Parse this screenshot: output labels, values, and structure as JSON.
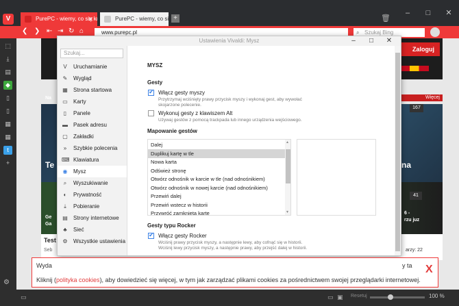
{
  "browser": {
    "logo": "V",
    "tabs": [
      {
        "title": "PurePC - wiemy, co się kręc"
      },
      {
        "title": "PurePC - wiemy, co się kręc"
      }
    ],
    "new_tab": "+",
    "url": "www.purepc.pl",
    "search_placeholder": "Szukaj Bing",
    "window_controls": [
      "–",
      "□",
      "✕"
    ]
  },
  "site": {
    "login": "Zaloguj",
    "section": "Więcej",
    "badge1": "167",
    "badge2": "41",
    "text_left1": "Na",
    "text_left2": "Te",
    "text_left3": "Ge",
    "text_left4": "Ga",
    "text_right1": "na",
    "text_right2": "6 -",
    "text_right3": "rzu juz",
    "footer_title": "Test",
    "footer_sub": "Seb",
    "footer_right": "arzy: 22"
  },
  "dialog": {
    "title": "Ustawienia Vivaldi: Mysz",
    "controls": [
      "–",
      "□",
      "✕"
    ],
    "search_placeholder": "Szukaj...",
    "nav": [
      {
        "label": "Uruchamianie",
        "icon": "V"
      },
      {
        "label": "Wygląd",
        "icon": "✎"
      },
      {
        "label": "Strona startowa",
        "icon": "▦"
      },
      {
        "label": "Karty",
        "icon": "▭"
      },
      {
        "label": "Panele",
        "icon": "▯"
      },
      {
        "label": "Pasek adresu",
        "icon": "▬"
      },
      {
        "label": "Zakładki",
        "icon": "▢"
      },
      {
        "label": "Szybkie polecenia",
        "icon": "»"
      },
      {
        "label": "Klawiatura",
        "icon": "⌨"
      },
      {
        "label": "Mysz",
        "icon": "◉"
      },
      {
        "label": "Wyszukiwanie",
        "icon": "⌕"
      },
      {
        "label": "Prywatność",
        "icon": "◐"
      },
      {
        "label": "Pobieranie",
        "icon": "⤓"
      },
      {
        "label": "Strony internetowe",
        "icon": "▤"
      },
      {
        "label": "Sieć",
        "icon": "♣"
      },
      {
        "label": "Wszystkie ustawienia",
        "icon": "⚙"
      }
    ],
    "heading": "MYSZ",
    "gestures_heading": "Gesty",
    "gesture_enable": "Włącz gesty myszy",
    "gesture_enable_desc1": "Przytrzymaj wciśnięty prawy przycisk myszy i wykonaj gest, aby wywołać",
    "gesture_enable_desc2": "skojarzone polecenie.",
    "gesture_alt": "Wykonuj gesty z klawiszem Alt",
    "gesture_alt_desc": "Używaj gestów z pomocą trackpada lub innego urządzenia wejściowego.",
    "mapping_heading": "Mapowanie gestów",
    "gestures": [
      "Dalej",
      "Duplikuj kartę w tle",
      "Nowa karta",
      "Odśwież stronę",
      "Otwórz odnośnik w karcie w tle (nad odnośnikiem)",
      "Otwórz odnośnik w nowej karcie (nad odnośnikiem)",
      "Przewiń dalej",
      "Przewiń wstecz w historii",
      "Przywróć zamkniętą kartę"
    ],
    "rocker_heading": "Gesty typu Rocker",
    "rocker_enable": "Włącz gesty Rocker",
    "rocker_desc1": "Wciśnij prawy przycisk myszy, a następnie lewy, aby cofnąć się w historii.",
    "rocker_desc2": "Wciśnij lewy przycisk myszy, a następnie prawy, aby przejść dalej w historii."
  },
  "cookie": {
    "line1": "Wyda",
    "line1_end": "y ta",
    "line2_a": "Kliknij (",
    "line2_link": "polityka cookies",
    "line2_b": "), aby dowiedzieć się więcej, w tym jak zarządzać plikami cookies za pośrednictwem swojej przeglądarki internetowej.",
    "close": "X"
  },
  "status": {
    "reset": "Resetuj",
    "zoom": "100 %"
  },
  "colors": {
    "accent": "#ef3939",
    "link": "#3c82e6"
  }
}
